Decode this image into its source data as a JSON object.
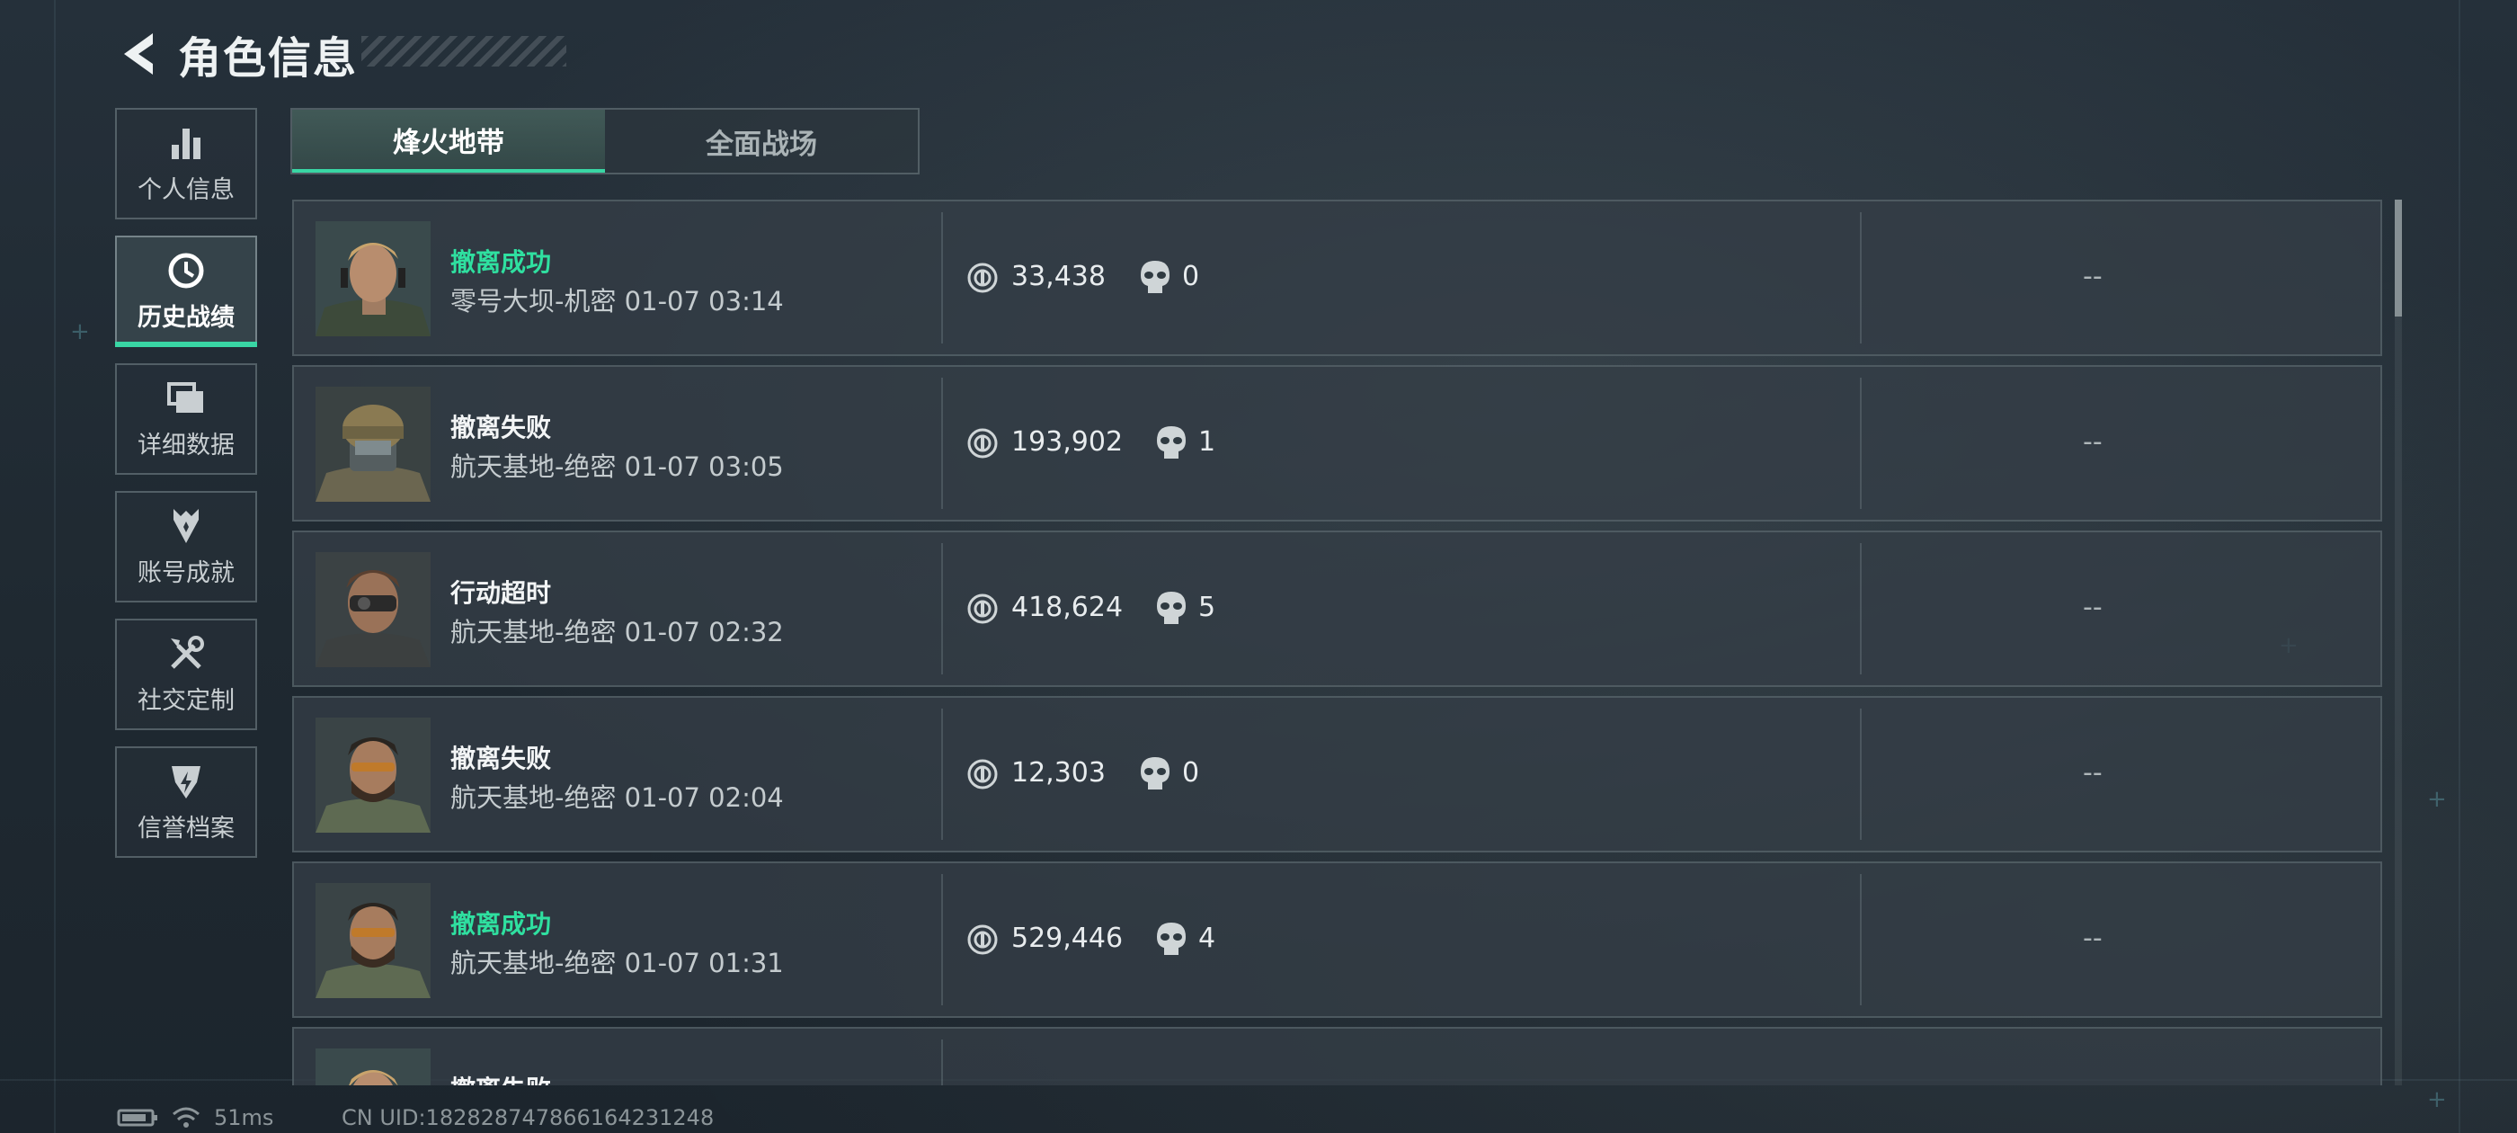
{
  "header": {
    "title": "角色信息"
  },
  "sidebar": {
    "items": [
      {
        "label": "个人信息",
        "icon": "bar-chart-icon",
        "active": false
      },
      {
        "label": "历史战绩",
        "icon": "history-icon",
        "active": true
      },
      {
        "label": "详细数据",
        "icon": "cards-icon",
        "active": false
      },
      {
        "label": "账号成就",
        "icon": "medal-icon",
        "active": false
      },
      {
        "label": "社交定制",
        "icon": "tools-icon",
        "active": false
      },
      {
        "label": "信誉档案",
        "icon": "shield-icon",
        "active": false
      }
    ]
  },
  "tabs": [
    {
      "label": "烽火地带",
      "active": true
    },
    {
      "label": "全面战场",
      "active": false
    }
  ],
  "records": [
    {
      "status": "撤离成功",
      "status_type": "success",
      "map": "零号大坝-机密 01-07 03:14",
      "value": "33,438",
      "kills": "0",
      "extra": "--"
    },
    {
      "status": "撤离失败",
      "status_type": "fail",
      "map": "航天基地-绝密 01-07 03:05",
      "value": "193,902",
      "kills": "1",
      "extra": "--"
    },
    {
      "status": "行动超时",
      "status_type": "fail",
      "map": "航天基地-绝密 01-07 02:32",
      "value": "418,624",
      "kills": "5",
      "extra": "--"
    },
    {
      "status": "撤离失败",
      "status_type": "fail",
      "map": "航天基地-绝密 01-07 02:04",
      "value": "12,303",
      "kills": "0",
      "extra": "--"
    },
    {
      "status": "撤离成功",
      "status_type": "success",
      "map": "航天基地-绝密 01-07 01:31",
      "value": "529,446",
      "kills": "4",
      "extra": "--"
    },
    {
      "status": "撤离失败",
      "status_type": "fail",
      "map": "",
      "value": "",
      "kills": "",
      "extra": ""
    }
  ],
  "footer": {
    "ping": "51ms",
    "uid": "CN UID:182828747866164231248"
  },
  "colors": {
    "accent": "#39d6a4",
    "success_text": "#2fe0a0"
  }
}
